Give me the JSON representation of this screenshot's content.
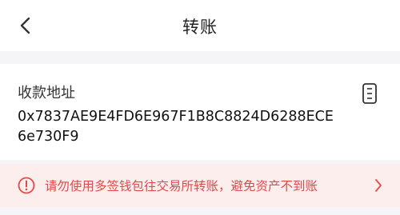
{
  "header": {
    "title": "转账",
    "back_icon": "chevron-left-icon"
  },
  "address_card": {
    "label": "收款地址",
    "address": "0x7837AE9E4FD6E967F1B8C8824D6288ECE6e730F9",
    "copy_icon": "copy-document-icon"
  },
  "warning": {
    "text": "请勿使用多签钱包往交易所转账，避免资产不到账",
    "icon": "exclamation-circle-icon",
    "chevron_icon": "chevron-right-icon",
    "color": "#e04a4a",
    "background": "#fdeeee"
  }
}
